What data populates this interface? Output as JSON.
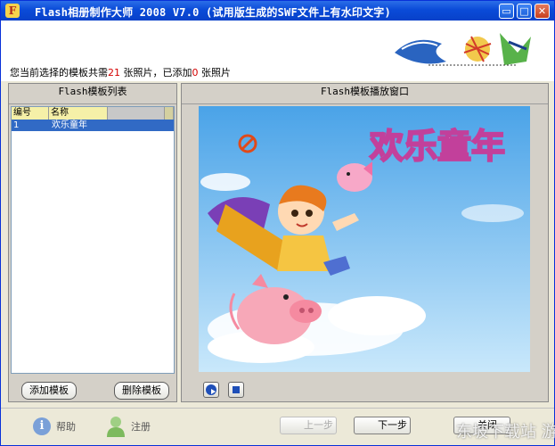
{
  "window": {
    "title": "Flash相册制作大师 2008 V7.0 (试用版生成的SWF文件上有水印文字)",
    "minimize_glyph": "▭",
    "maximize_glyph": "□",
    "close_glyph": "✕"
  },
  "info": {
    "prefix": "您当前选择的模板共需",
    "required_count": "21",
    "middle": " 张照片，已添加",
    "added_count": "0",
    "suffix": " 张照片"
  },
  "template_list": {
    "title": "Flash模板列表",
    "col_number": "编号",
    "col_name": "名称",
    "rows": [
      {
        "number": "1",
        "name": "欢乐童年"
      }
    ],
    "add_button": "添加模板",
    "remove_button": "删除模板"
  },
  "player": {
    "title": "Flash模板播放窗口",
    "stage_text": "欢乐童年"
  },
  "footer": {
    "help_label": "帮助",
    "register_label": "注册",
    "back_button": "上一步",
    "next_button": "下一步",
    "close_button": "关闭"
  },
  "watermark": "东坡下载站 游网"
}
